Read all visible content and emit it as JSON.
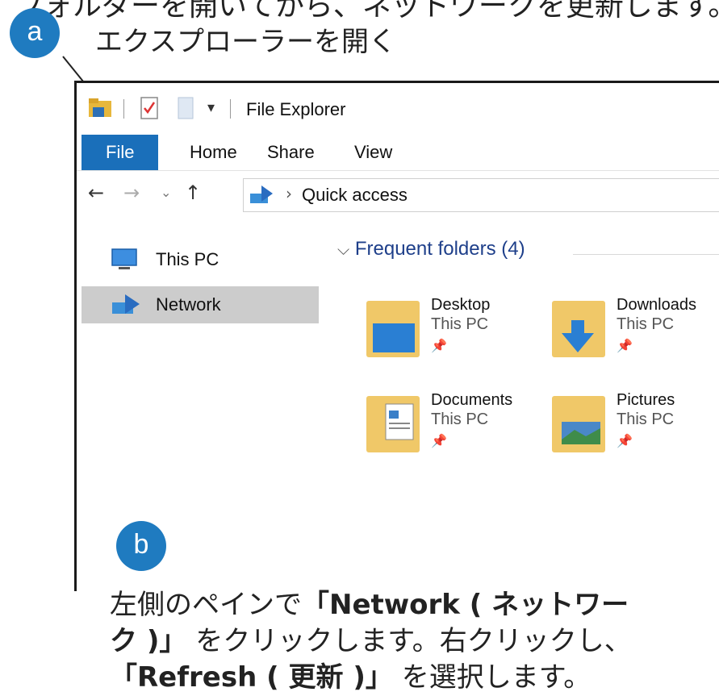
{
  "heading_cut": "フォルダーを開いてから、ネットワークを更新します。",
  "step_a": {
    "badge": "a",
    "text": "エクスプローラーを開く"
  },
  "step_b": {
    "badge": "b",
    "text_1": "左側のペインで",
    "bold_1": "「Network ( ネットワー",
    "bold_2": "ク )」",
    "text_2": "をクリックします。右クリックし、",
    "bold_3": "「Refresh ( 更新 )」",
    "text_3": "を選択します。"
  },
  "window": {
    "title": "File Explorer",
    "quick_access_icons": [
      "folder-icon",
      "properties-icon",
      "new-folder-icon",
      "customize-icon"
    ],
    "ribbon_tabs": [
      "File",
      "Home",
      "Share",
      "View"
    ],
    "nav_buttons": [
      "back-arrow-icon",
      "forward-arrow-icon",
      "recent-dropdown-icon",
      "up-arrow-icon"
    ],
    "address": "Quick access",
    "nav_pane": [
      {
        "label": "This PC",
        "icon": "computer-icon",
        "selected": false
      },
      {
        "label": "Network",
        "icon": "network-icon",
        "selected": true
      }
    ],
    "group_header": "Frequent folders (4)",
    "folders": [
      {
        "name": "Desktop",
        "location": "This PC",
        "icon": "desktop-folder-icon"
      },
      {
        "name": "Downloads",
        "location": "This PC",
        "icon": "downloads-folder-icon"
      },
      {
        "name": "Documents",
        "location": "This PC",
        "icon": "documents-folder-icon"
      },
      {
        "name": "Pictures",
        "location": "This PC",
        "icon": "pictures-folder-icon"
      }
    ]
  },
  "colors": {
    "accent": "#1f7bc0",
    "file_tab": "#1a6fba",
    "group_header": "#1e3f8a",
    "selected": "#cccccc"
  }
}
